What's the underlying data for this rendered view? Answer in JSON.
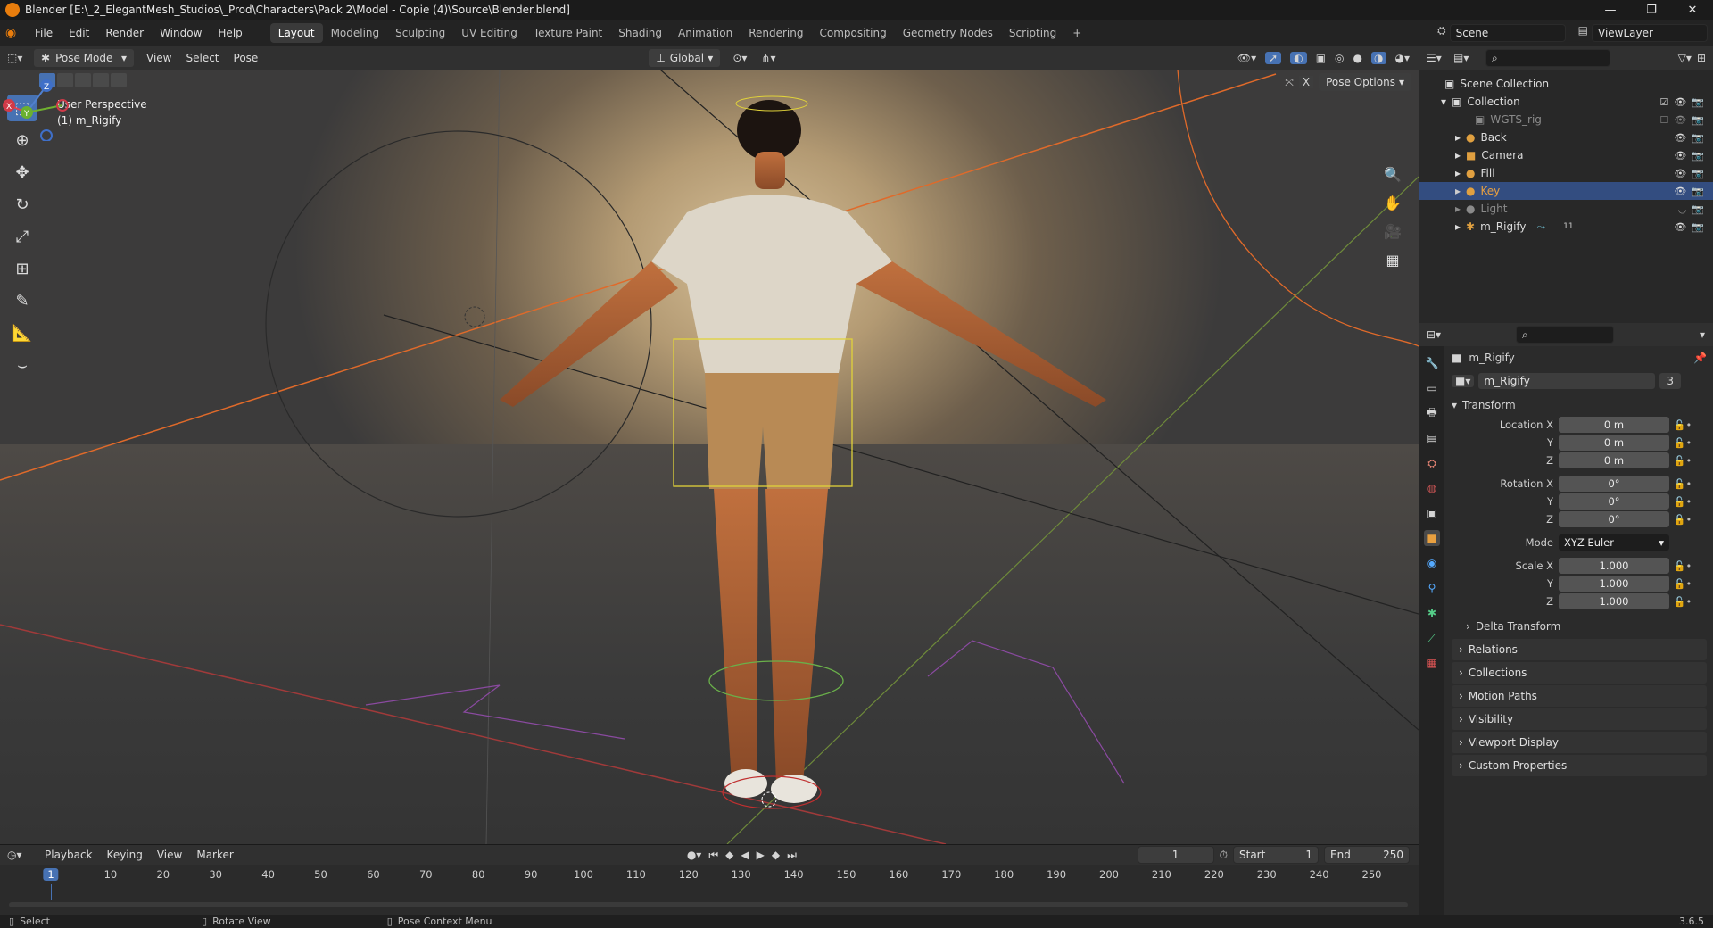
{
  "titlebar": {
    "title": "Blender [E:\\_2_ElegantMesh_Studios\\_Prod\\Characters\\Pack 2\\Model - Copie (4)\\Source\\Blender.blend]",
    "minimize": "—",
    "maximize": "❐",
    "close": "✕"
  },
  "menu": [
    "File",
    "Edit",
    "Render",
    "Window",
    "Help"
  ],
  "workspaces": [
    "Layout",
    "Modeling",
    "Sculpting",
    "UV Editing",
    "Texture Paint",
    "Shading",
    "Animation",
    "Rendering",
    "Compositing",
    "Geometry Nodes",
    "Scripting",
    "+"
  ],
  "scene": {
    "name": "Scene",
    "view_layer": "ViewLayer"
  },
  "viewport_header": {
    "mode": "Pose Mode",
    "menus": [
      "View",
      "Select",
      "Pose"
    ],
    "orientation": "Global",
    "pose_options": "Pose Options"
  },
  "viewport_info": {
    "line1": "User Perspective",
    "line2": "(1) m_Rigify"
  },
  "gizmo": {
    "z": "Z",
    "y": "Y",
    "x": "X"
  },
  "outliner": {
    "root": "Scene Collection",
    "collection": "Collection",
    "items": [
      {
        "label": "WGTS_rig",
        "state": "dim"
      },
      {
        "label": "Back",
        "state": "normal"
      },
      {
        "label": "Camera",
        "state": "normal"
      },
      {
        "label": "Fill",
        "state": "normal"
      },
      {
        "label": "Key",
        "state": "selected"
      },
      {
        "label": "Light",
        "state": "dim"
      },
      {
        "label": "m_Rigify",
        "state": "normal"
      }
    ],
    "rigify_badge": "11"
  },
  "properties": {
    "object_name": "m_Rigify",
    "data_name": "m_Rigify",
    "users": "3",
    "transform_label": "Transform",
    "location": {
      "label": "Location X",
      "x": "0 m",
      "y": "0 m",
      "z": "0 m"
    },
    "rotation": {
      "label": "Rotation X",
      "x": "0°",
      "y": "0°",
      "z": "0°"
    },
    "mode": {
      "label": "Mode",
      "value": "XYZ Euler"
    },
    "scale": {
      "label": "Scale X",
      "x": "1.000",
      "y": "1.000",
      "z": "1.000"
    },
    "axis_y": "Y",
    "axis_z": "Z",
    "panels": [
      "Delta Transform",
      "Relations",
      "Collections",
      "Motion Paths",
      "Visibility",
      "Viewport Display",
      "Custom Properties"
    ]
  },
  "timeline": {
    "menus": [
      "Playback",
      "Keying",
      "View",
      "Marker"
    ],
    "current_frame": "1",
    "start_label": "Start",
    "start": "1",
    "end_label": "End",
    "end": "250",
    "ticks": [
      "10",
      "20",
      "30",
      "40",
      "50",
      "60",
      "70",
      "80",
      "90",
      "100",
      "110",
      "120",
      "130",
      "140",
      "150",
      "160",
      "170",
      "180",
      "190",
      "200",
      "210",
      "220",
      "230",
      "240",
      "250"
    ]
  },
  "status": {
    "select": "Select",
    "rotate": "Rotate View",
    "context": "Pose Context Menu",
    "version": "3.6.5"
  }
}
